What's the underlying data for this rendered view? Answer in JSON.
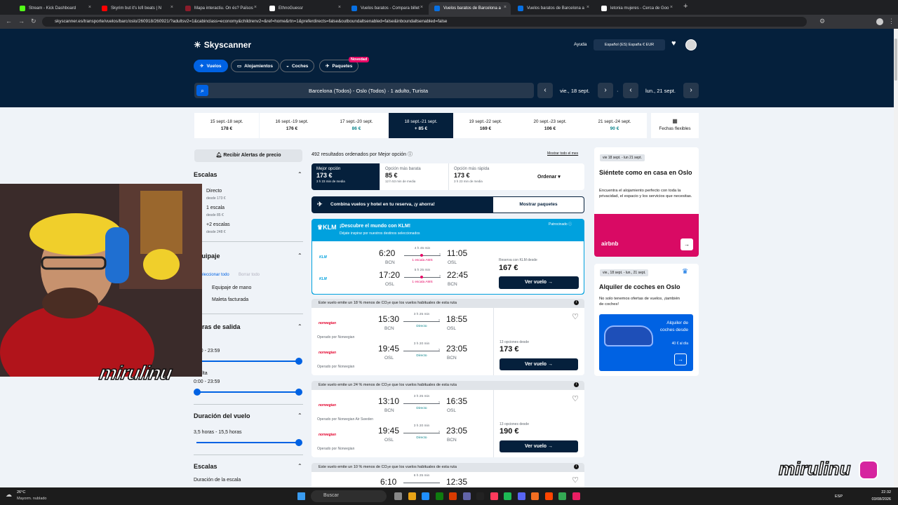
{
  "browser": {
    "tabs": [
      {
        "label": "Stream - Kick Dashboard",
        "color": "#53fc18"
      },
      {
        "label": "Skyrim but it's lofi beats | N",
        "color": "#ff0000"
      },
      {
        "label": "Mapa interactiu. On és? Països",
        "color": "#8b1c2b"
      },
      {
        "label": "EthnoGuessr",
        "color": "#ffffff"
      },
      {
        "label": "Vuelos baratos - Compara billet",
        "color": "#0770e3"
      },
      {
        "label": "Vuelos baratos de Barcelona a",
        "color": "#0770e3"
      },
      {
        "label": "Vuelos baratos de Barcelona a",
        "color": "#0770e3"
      },
      {
        "label": "letonia mujeres - Cerca de Goo",
        "color": "#ffffff"
      }
    ],
    "url": "skyscanner.es/transporte/vuelos/barc/oslo/260918/260921/?adultsv2=1&cabinclass=economy&childrenv2=&ref=home&rtn=1&preferdirects=false&outboundaltsenabled=false&inboundaltsenabled=false"
  },
  "header": {
    "logo": "Skyscanner",
    "nav": [
      "Vuelos",
      "Alojamientos",
      "Coches",
      "Paquetes"
    ],
    "novedad": "Novedad",
    "ayuda": "Ayuda",
    "locale": "Español (ES)   España   € EUR",
    "search_summary": "Barcelona (Todos) - Oslo (Todos)  ·  1 adulto, Turista",
    "depart": "vie., 18 sept.",
    "return": "lun., 21 sept."
  },
  "dates": [
    {
      "d": "15 sept.-18 sept.",
      "p": "178 €",
      "green": false
    },
    {
      "d": "16 sept.-19 sept.",
      "p": "176 €",
      "green": false
    },
    {
      "d": "17 sept.-20 sept.",
      "p": "86 €",
      "green": true
    },
    {
      "d": "18 sept.-21 sept.",
      "p": "+ 85 €",
      "green": false
    },
    {
      "d": "19 sept.-22 sept.",
      "p": "169 €",
      "green": false
    },
    {
      "d": "20 sept.-23 sept.",
      "p": "106 €",
      "green": false
    },
    {
      "d": "21 sept.-24 sept.",
      "p": "90 €",
      "green": true
    }
  ],
  "flexible": "Fechas flexibles",
  "filters": {
    "alert": "Recibir Alertas de precio",
    "escalas": "Escalas",
    "directo": "Directo",
    "directo_sub": "desde 173 €",
    "una": "1 escala",
    "una_sub": "desde 85 €",
    "dos": "+2 escalas",
    "dos_sub": "desde 248 €",
    "equipaje": "Equipaje",
    "seleccionar": "Seleccionar todo",
    "borrar": "Borrar todo",
    "mano": "Equipaje de mano",
    "facturada": "Maleta facturada",
    "horas": "Horas de salida",
    "ida_range": "0:00 - 23:59",
    "vuelta": "Vuelta",
    "vuelta_range": "0:00 - 23:59",
    "duracion": "Duración del vuelo",
    "duracion_range": "3,5 horas - 15,5 horas",
    "escalas2": "Escalas",
    "duracion_escala": "Duración de la escala"
  },
  "results": {
    "count": "492 resultados ordenados por Mejor opción",
    "mostrar": "Mostrar todo el mes",
    "sort": [
      {
        "t": "Mejor opción",
        "p": "173 €",
        "s": "3 h 23 min de media"
      },
      {
        "t": "Opción más barata",
        "p": "85 €",
        "s": "12 h 53 min de media"
      },
      {
        "t": "Opción más rápida",
        "p": "173 €",
        "s": "3 h 23 min de media"
      }
    ],
    "ordenar": "Ordenar",
    "combo": "Combina vuelos y hotel en tu reserva, ¡y ahorra!",
    "combo_link": "Mostrar paquetes"
  },
  "klm": {
    "title": "¡Descubre el mundo con KLM!",
    "sub": "Déjate inspirar por nuestros destinos seleccionados",
    "patrocinado": "Patrocinado",
    "out": {
      "dep": "6:20",
      "from": "BCN",
      "dur": "4 h 45 min",
      "stop": "1 escala AMS",
      "arr": "11:05",
      "to": "OSL"
    },
    "ret": {
      "dep": "17:20",
      "from": "OSL",
      "dur": "5 h 25 min",
      "stop": "1 escala AMS",
      "arr": "22:45",
      "to": "BCN"
    },
    "label": "Reserva con KLM desde",
    "price": "167 €",
    "btn": "Ver vuelo"
  },
  "cards": [
    {
      "co": "Este vuelo emite un 18 % menos de CO₂e que los vuelos habituales de esta ruta",
      "op1": "Operado por Norwegian",
      "op2": "Operado por Norwegian",
      "out": {
        "dep": "15:30",
        "from": "BCN",
        "dur": "3 h 25 min",
        "stop": "Directo",
        "arr": "18:55",
        "to": "OSL"
      },
      "ret": {
        "dep": "19:45",
        "from": "OSL",
        "dur": "3 h 20 min",
        "stop": "Directo",
        "arr": "23:05",
        "to": "BCN"
      },
      "opts": "13 opciones desde",
      "price": "173 €",
      "btn": "Ver vuelo"
    },
    {
      "co": "Este vuelo emite un 24 % menos de CO₂e que los vuelos habituales de esta ruta",
      "op1": "Operado por Norwegian Air Sweden",
      "op2": "Operado por Norwegian",
      "out": {
        "dep": "13:10",
        "from": "BCN",
        "dur": "3 h 25 min",
        "stop": "Directo",
        "arr": "16:35",
        "to": "OSL"
      },
      "ret": {
        "dep": "19:45",
        "from": "OSL",
        "dur": "3 h 20 min",
        "stop": "Directo",
        "arr": "23:05",
        "to": "BCN"
      },
      "opts": "13 opciones desde",
      "price": "190 €",
      "btn": "Ver vuelo"
    },
    {
      "co": "Este vuelo emite un 10 % menos de CO₂e que los vuelos habituales de esta ruta",
      "out": {
        "dep": "6:10",
        "dur": "6 h 25 min",
        "arr": "12:35"
      }
    }
  ],
  "ads": {
    "hotel_dates": "vie 18 sept. - lun 21 sept.",
    "hotel_title": "Siéntete como en casa en Oslo",
    "hotel_text": "Encuentra el alojamiento perfecto con toda la privacidad, el espacio y los servicios que necesitas.",
    "airbnb": "airbnb",
    "car_dates": "vie., 18 sept. - lun., 21 sept.",
    "car_title": "Alquiler de coches en Oslo",
    "car_text": "No solo tenemos ofertas de vuelos, ¡también de coches!",
    "car_banner": "Alquiler de coches desde",
    "car_price": "40 € al día"
  },
  "overlay": {
    "watermark": "mirulinu",
    "brand": "mirulinu"
  },
  "taskbar": {
    "temp": "26°C",
    "weather": "Mayorm. nublado",
    "search": "Buscar",
    "lang": "ESP",
    "time": "22:32",
    "date": "03/08/2026"
  }
}
